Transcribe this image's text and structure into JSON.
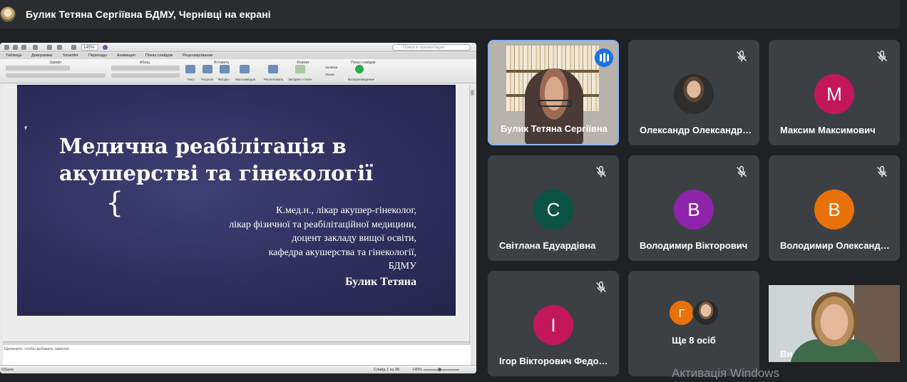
{
  "header": {
    "presenter_title": "Булик Тетяна Сергіївна БДМУ, Чернівці на екрані"
  },
  "presentation": {
    "zoom": "145%",
    "search_placeholder": "Поиск в презентации",
    "tabs": [
      "Таблицы",
      "Диаграммы",
      "SmartArt",
      "Переходы",
      "Анимация",
      "Показ слайдов",
      "Рецензирование"
    ],
    "ribbon_groups": [
      "Шрифт",
      "Абзац",
      "Вставить",
      "Формат",
      "Показ слайдов"
    ],
    "ribbon_labels": [
      "Текст",
      "Рисунок",
      "Фигуры",
      "Мультимедиа",
      "Расположить",
      "Экспресс-стили",
      "Заливка",
      "Линия",
      "Воспроизведение"
    ],
    "slide": {
      "title_line1": "Медична реабілітація в",
      "title_line2": "акушерстві та гінекології",
      "brace": "{",
      "author_lines": [
        "К.мед.н., лікар акушер-гінеколог,",
        "лікар фізичної та реабілітаційної медицини,",
        "доцент закладу вищої освіти,",
        "кафедра акушерства та гінекології,",
        "БДМУ"
      ],
      "author_name": "Булик Тетяна"
    },
    "notes_placeholder": "Щелкните, чтобы добавить заметки",
    "status": {
      "view": "Обычн",
      "slide_counter": "Слайд 1 из 38",
      "zoom": "145%"
    }
  },
  "participants": [
    {
      "name": "Булик Тетяна Сергіївна",
      "speaking": true
    },
    {
      "name": "Олександр Олександрович",
      "muted": true
    },
    {
      "name": "Максим Максимович",
      "initial": "М",
      "color": "#c2185b",
      "muted": true
    },
    {
      "name": "Світлана Едуардівна",
      "initial": "С",
      "color": "#0b5345",
      "muted": true
    },
    {
      "name": "Володимир Вікторович",
      "initial": "В",
      "color": "#8e24aa",
      "muted": true
    },
    {
      "name": "Володимир Олександрович",
      "initial": "В",
      "color": "#e8710a",
      "muted": true
    },
    {
      "name": "Ігор Вікторович Федорович",
      "initial": "І",
      "color": "#c2185b",
      "muted": true
    }
  ],
  "more_tile": {
    "initial": "Г",
    "color": "#e8710a",
    "label": "Ще 8 осіб"
  },
  "self_tile": {
    "label": "Ви"
  },
  "watermark": "Активація Windows"
}
